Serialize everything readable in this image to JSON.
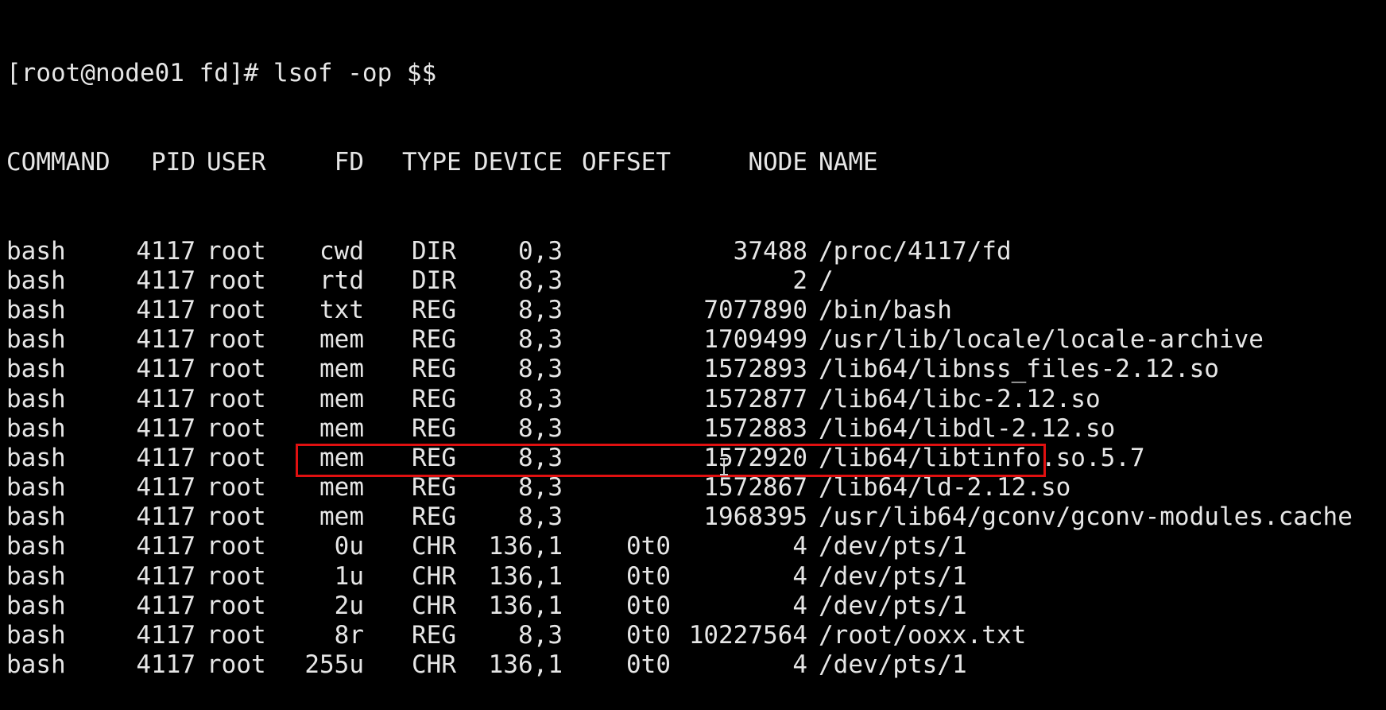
{
  "terminal": {
    "prompt": "[root@node01 fd]# lsof -op $$",
    "headers": {
      "command": "COMMAND",
      "pid": "PID",
      "user": "USER",
      "fd": "FD",
      "type": "TYPE",
      "device": "DEVICE",
      "offset": "OFFSET",
      "node": "NODE",
      "name": "NAME"
    },
    "rows": [
      {
        "command": "bash",
        "pid": "4117",
        "user": "root",
        "fd": "cwd",
        "type": "DIR",
        "device": "0,3",
        "offset": "",
        "node": "37488",
        "name": "/proc/4117/fd"
      },
      {
        "command": "bash",
        "pid": "4117",
        "user": "root",
        "fd": "rtd",
        "type": "DIR",
        "device": "8,3",
        "offset": "",
        "node": "2",
        "name": "/"
      },
      {
        "command": "bash",
        "pid": "4117",
        "user": "root",
        "fd": "txt",
        "type": "REG",
        "device": "8,3",
        "offset": "",
        "node": "7077890",
        "name": "/bin/bash"
      },
      {
        "command": "bash",
        "pid": "4117",
        "user": "root",
        "fd": "mem",
        "type": "REG",
        "device": "8,3",
        "offset": "",
        "node": "1709499",
        "name": "/usr/lib/locale/locale-archive"
      },
      {
        "command": "bash",
        "pid": "4117",
        "user": "root",
        "fd": "mem",
        "type": "REG",
        "device": "8,3",
        "offset": "",
        "node": "1572893",
        "name": "/lib64/libnss_files-2.12.so"
      },
      {
        "command": "bash",
        "pid": "4117",
        "user": "root",
        "fd": "mem",
        "type": "REG",
        "device": "8,3",
        "offset": "",
        "node": "1572877",
        "name": "/lib64/libc-2.12.so"
      },
      {
        "command": "bash",
        "pid": "4117",
        "user": "root",
        "fd": "mem",
        "type": "REG",
        "device": "8,3",
        "offset": "",
        "node": "1572883",
        "name": "/lib64/libdl-2.12.so"
      },
      {
        "command": "bash",
        "pid": "4117",
        "user": "root",
        "fd": "mem",
        "type": "REG",
        "device": "8,3",
        "offset": "",
        "node": "1572920",
        "name": "/lib64/libtinfo.so.5.7"
      },
      {
        "command": "bash",
        "pid": "4117",
        "user": "root",
        "fd": "mem",
        "type": "REG",
        "device": "8,3",
        "offset": "",
        "node": "1572867",
        "name": "/lib64/ld-2.12.so"
      },
      {
        "command": "bash",
        "pid": "4117",
        "user": "root",
        "fd": "mem",
        "type": "REG",
        "device": "8,3",
        "offset": "",
        "node": "1968395",
        "name": "/usr/lib64/gconv/gconv-modules.cache"
      },
      {
        "command": "bash",
        "pid": "4117",
        "user": "root",
        "fd": "0u",
        "type": "CHR",
        "device": "136,1",
        "offset": "0t0",
        "node": "4",
        "name": "/dev/pts/1"
      },
      {
        "command": "bash",
        "pid": "4117",
        "user": "root",
        "fd": "1u",
        "type": "CHR",
        "device": "136,1",
        "offset": "0t0",
        "node": "4",
        "name": "/dev/pts/1"
      },
      {
        "command": "bash",
        "pid": "4117",
        "user": "root",
        "fd": "2u",
        "type": "CHR",
        "device": "136,1",
        "offset": "0t0",
        "node": "4",
        "name": "/dev/pts/1"
      },
      {
        "command": "bash",
        "pid": "4117",
        "user": "root",
        "fd": "8r",
        "type": "REG",
        "device": "8,3",
        "offset": "0t0",
        "node": "10227564",
        "name": "/root/ooxx.txt"
      },
      {
        "command": "bash",
        "pid": "4117",
        "user": "root",
        "fd": "255u",
        "type": "CHR",
        "device": "136,1",
        "offset": "0t0",
        "node": "4",
        "name": "/dev/pts/1"
      }
    ]
  },
  "colors": {
    "background": "#000000",
    "text": "#e6e6e6",
    "highlight": "#e01010"
  },
  "icons": {
    "cursor": "text-cursor-icon"
  }
}
